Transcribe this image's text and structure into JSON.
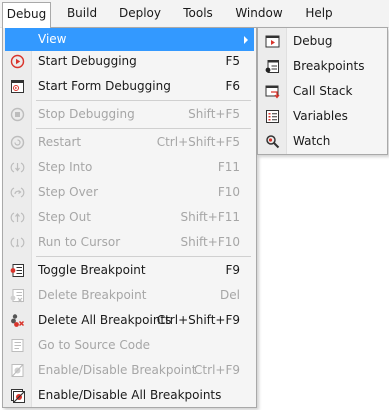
{
  "menubar": {
    "items": [
      {
        "label": "Debug"
      },
      {
        "label": "Build"
      },
      {
        "label": "Deploy"
      },
      {
        "label": "Tools"
      },
      {
        "label": "Window"
      },
      {
        "label": "Help"
      }
    ]
  },
  "debug_menu": {
    "items": [
      {
        "label": "View",
        "shortcut": "",
        "icon": "none",
        "state": "highlighted",
        "has_submenu": true
      },
      {
        "label": "Start Debugging",
        "shortcut": "F5",
        "icon": "play-circle-icon",
        "state": "enabled"
      },
      {
        "label": "Start Form Debugging",
        "shortcut": "F6",
        "icon": "form-debug-icon",
        "state": "enabled"
      },
      {
        "label": "Stop Debugging",
        "shortcut": "Shift+F5",
        "icon": "stop-circle-icon",
        "state": "disabled"
      },
      {
        "label": "Restart",
        "shortcut": "Ctrl+Shift+F5",
        "icon": "restart-icon",
        "state": "disabled"
      },
      {
        "label": "Step Into",
        "shortcut": "F11",
        "icon": "step-into-icon",
        "state": "disabled"
      },
      {
        "label": "Step Over",
        "shortcut": "F10",
        "icon": "step-over-icon",
        "state": "disabled"
      },
      {
        "label": "Step Out",
        "shortcut": "Shift+F11",
        "icon": "step-out-icon",
        "state": "disabled"
      },
      {
        "label": "Run to Cursor",
        "shortcut": "Shift+F10",
        "icon": "run-to-cursor-icon",
        "state": "disabled"
      },
      {
        "label": "Toggle Breakpoint",
        "shortcut": "F9",
        "icon": "toggle-breakpoint-icon",
        "state": "enabled"
      },
      {
        "label": "Delete Breakpoint",
        "shortcut": "Del",
        "icon": "delete-breakpoint-icon",
        "state": "disabled"
      },
      {
        "label": "Delete All Breakpoints",
        "shortcut": "Ctrl+Shift+F9",
        "icon": "delete-all-breakpoints-icon",
        "state": "enabled"
      },
      {
        "label": "Go to Source Code",
        "shortcut": "",
        "icon": "go-to-source-icon",
        "state": "disabled"
      },
      {
        "label": "Enable/Disable Breakpoint",
        "shortcut": "Ctrl+F9",
        "icon": "enable-disable-breakpoint-icon",
        "state": "disabled"
      },
      {
        "label": "Enable/Disable All Breakpoints",
        "shortcut": "",
        "icon": "enable-disable-all-breakpoints-icon",
        "state": "enabled"
      }
    ]
  },
  "view_submenu": {
    "items": [
      {
        "label": "Debug",
        "icon": "debug-window-icon"
      },
      {
        "label": "Breakpoints",
        "icon": "breakpoints-window-icon"
      },
      {
        "label": "Call Stack",
        "icon": "call-stack-icon"
      },
      {
        "label": "Variables",
        "icon": "variables-icon"
      },
      {
        "label": "Watch",
        "icon": "watch-icon"
      }
    ]
  },
  "colors": {
    "highlight": "#3399ff",
    "disabled_text": "#a6a6a6",
    "menu_background": "#f5f5f5",
    "breakpoint_red": "#d9342b"
  }
}
